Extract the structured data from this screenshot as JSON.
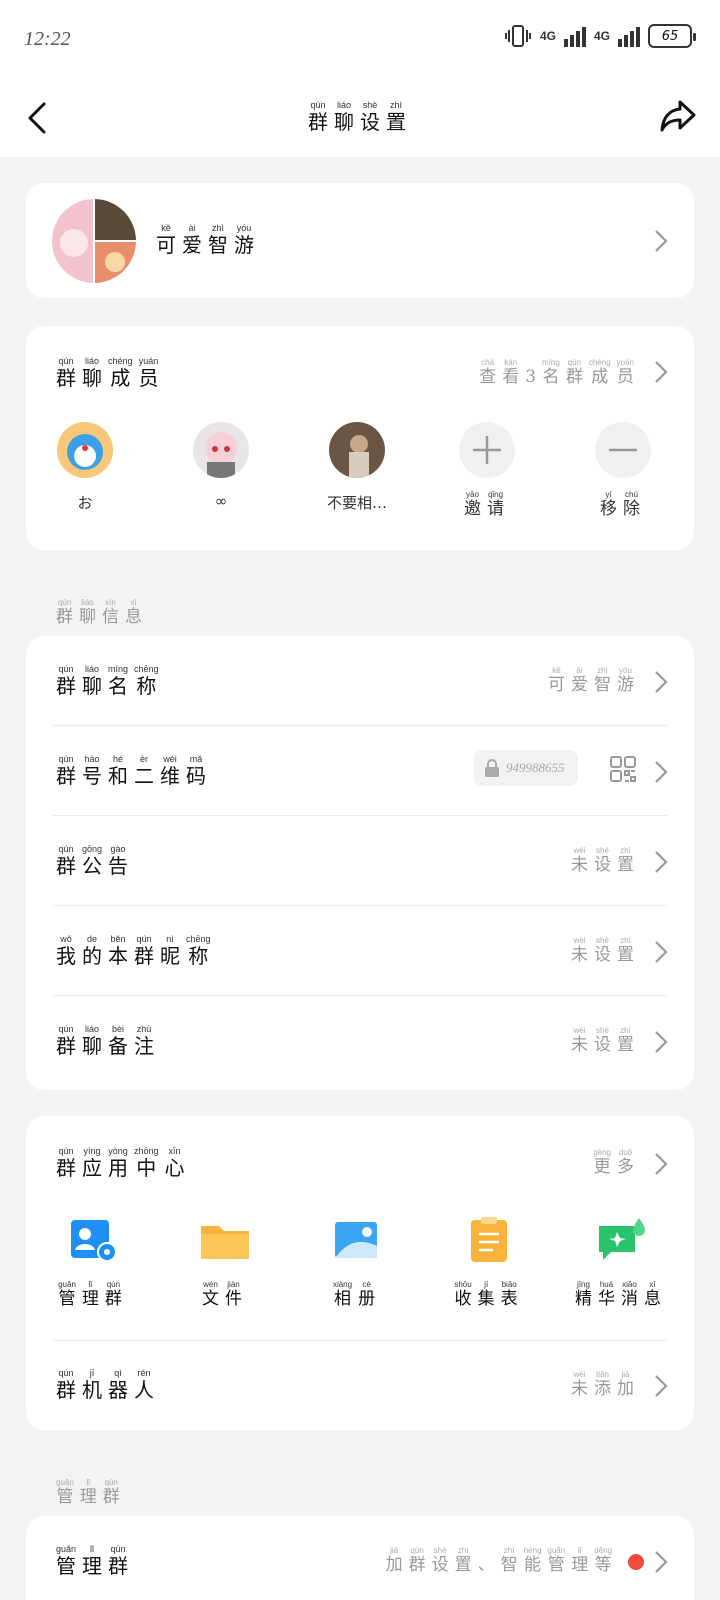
{
  "status_bar": {
    "time": "12:22",
    "signal1": "4G",
    "signal2": "4G",
    "battery": "65"
  },
  "nav": {
    "title": [
      [
        "qún",
        "群"
      ],
      [
        "liáo",
        "聊"
      ],
      [
        "shè",
        "设"
      ],
      [
        "zhì",
        "置"
      ]
    ]
  },
  "group_header": {
    "name": [
      [
        "kě",
        "可"
      ],
      [
        "ài",
        "爱"
      ],
      [
        "zhì",
        "智"
      ],
      [
        "yóu",
        "游"
      ]
    ]
  },
  "members_card": {
    "title": [
      [
        "qún",
        "群"
      ],
      [
        "liáo",
        "聊"
      ],
      [
        "chéng",
        "成"
      ],
      [
        "yuán",
        "员"
      ]
    ],
    "view_all": [
      [
        "chá",
        "查"
      ],
      [
        "kàn",
        "看"
      ],
      [
        "3",
        ""
      ],
      [
        "míng",
        "名"
      ],
      [
        "qún",
        "群"
      ],
      [
        "chéng",
        "成"
      ],
      [
        "yuán",
        "员"
      ]
    ],
    "members": [
      {
        "name": "お"
      },
      {
        "name": "∞"
      },
      {
        "name": "不要相…"
      }
    ],
    "invite": [
      [
        "yāo",
        "邀"
      ],
      [
        "qǐng",
        "请"
      ]
    ],
    "remove": [
      [
        "yí",
        "移"
      ],
      [
        "chú",
        "除"
      ]
    ]
  },
  "section_info": [
    [
      "qún",
      "群"
    ],
    [
      "liáo",
      "聊"
    ],
    [
      "xìn",
      "信"
    ],
    [
      "xī",
      "息"
    ]
  ],
  "info_rows": {
    "group_name": {
      "label": [
        [
          "qún",
          "群"
        ],
        [
          "liáo",
          "聊"
        ],
        [
          "míng",
          "名"
        ],
        [
          "chēng",
          "称"
        ]
      ],
      "value": [
        [
          "kě",
          "可"
        ],
        [
          "ài",
          "爱"
        ],
        [
          "zhì",
          "智"
        ],
        [
          "yóu",
          "游"
        ]
      ]
    },
    "group_id": {
      "label": [
        [
          "qún",
          "群"
        ],
        [
          "hào",
          "号"
        ],
        [
          "hé",
          "和"
        ],
        [
          "èr",
          "二"
        ],
        [
          "wéi",
          "维"
        ],
        [
          "mǎ",
          "码"
        ]
      ],
      "id": "949988655"
    },
    "announcement": {
      "label": [
        [
          "qún",
          "群"
        ],
        [
          "gōng",
          "公"
        ],
        [
          "gào",
          "告"
        ]
      ],
      "value": [
        [
          "wèi",
          "未"
        ],
        [
          "shè",
          "设"
        ],
        [
          "zhì",
          "置"
        ]
      ]
    },
    "my_nickname": {
      "label": [
        [
          "wǒ",
          "我"
        ],
        [
          "de",
          "的"
        ],
        [
          "běn",
          "本"
        ],
        [
          "qún",
          "群"
        ],
        [
          "nì",
          "昵"
        ],
        [
          "chēng",
          "称"
        ]
      ],
      "value": [
        [
          "wèi",
          "未"
        ],
        [
          "shè",
          "设"
        ],
        [
          "zhì",
          "置"
        ]
      ]
    },
    "remark": {
      "label": [
        [
          "qún",
          "群"
        ],
        [
          "liáo",
          "聊"
        ],
        [
          "bèi",
          "备"
        ],
        [
          "zhù",
          "注"
        ]
      ],
      "value": [
        [
          "wèi",
          "未"
        ],
        [
          "shè",
          "设"
        ],
        [
          "zhì",
          "置"
        ]
      ]
    }
  },
  "apps_card": {
    "title": [
      [
        "qún",
        "群"
      ],
      [
        "yìng",
        "应"
      ],
      [
        "yòng",
        "用"
      ],
      [
        "zhōng",
        "中"
      ],
      [
        "xīn",
        "心"
      ]
    ],
    "more": [
      [
        "gèng",
        "更"
      ],
      [
        "duō",
        "多"
      ]
    ],
    "apps": [
      {
        "icon": "manage-group-icon",
        "color": "#1e8ff5",
        "label": [
          [
            "guǎn",
            "管"
          ],
          [
            "lǐ",
            "理"
          ],
          [
            "qún",
            "群"
          ]
        ]
      },
      {
        "icon": "folder-icon",
        "color": "#f9b33b",
        "label": [
          [
            "wén",
            "文"
          ],
          [
            "jiàn",
            "件"
          ]
        ]
      },
      {
        "icon": "album-icon",
        "color": "#3aa5f2",
        "label": [
          [
            "xiàng",
            "相"
          ],
          [
            "cè",
            "册"
          ]
        ]
      },
      {
        "icon": "clipboard-icon",
        "color": "#f9b33b",
        "label": [
          [
            "shōu",
            "收"
          ],
          [
            "jí",
            "集"
          ],
          [
            "biǎo",
            "表"
          ]
        ]
      },
      {
        "icon": "essence-message-icon",
        "color": "#27c46b",
        "label": [
          [
            "jīng",
            "精"
          ],
          [
            "huá",
            "华"
          ],
          [
            "xiāo",
            "消"
          ],
          [
            "xī",
            "息"
          ]
        ]
      }
    ],
    "robot": {
      "label": [
        [
          "qún",
          "群"
        ],
        [
          "jī",
          "机"
        ],
        [
          "qì",
          "器"
        ],
        [
          "rén",
          "人"
        ]
      ],
      "value": [
        [
          "wèi",
          "未"
        ],
        [
          "tiān",
          "添"
        ],
        [
          "jiā",
          "加"
        ]
      ]
    }
  },
  "section_manage": [
    [
      "guǎn",
      "管"
    ],
    [
      "lǐ",
      "理"
    ],
    [
      "qún",
      "群"
    ]
  ],
  "manage_row": {
    "label": [
      [
        "guǎn",
        "管"
      ],
      [
        "lǐ",
        "理"
      ],
      [
        "qún",
        "群"
      ]
    ],
    "value": [
      [
        "jiā",
        "加"
      ],
      [
        "qún",
        "群"
      ],
      [
        "shè",
        "设"
      ],
      [
        "zhì",
        "置"
      ],
      [
        "",
        ""
      ],
      [
        "zhì",
        "智"
      ],
      [
        "néng",
        "能"
      ],
      [
        "guǎn",
        "管"
      ],
      [
        "lǐ",
        "理"
      ],
      [
        "děng",
        "等"
      ]
    ],
    "dot_color": "#f04b3b"
  }
}
